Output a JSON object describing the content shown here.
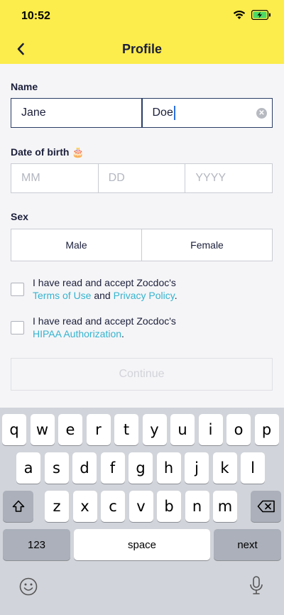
{
  "status": {
    "time": "10:52"
  },
  "nav": {
    "title": "Profile"
  },
  "form": {
    "name_label": "Name",
    "first_name": "Jane",
    "last_name": "Doe",
    "dob_label": "Date of birth",
    "dob_emoji": "🎂",
    "dob_month_placeholder": "MM",
    "dob_day_placeholder": "DD",
    "dob_year_placeholder": "YYYY",
    "sex_label": "Sex",
    "sex_male": "Male",
    "sex_female": "Female",
    "terms_prefix": "I have read and accept Zocdoc's",
    "terms_link": "Terms of Use",
    "terms_and": "and",
    "privacy_link": "Privacy Policy",
    "terms_period": ".",
    "hipaa_prefix": "I have read and accept Zocdoc's",
    "hipaa_link": "HIPAA Authorization",
    "hipaa_period": ".",
    "continue_label": "Continue"
  },
  "keyboard": {
    "row1": [
      "q",
      "w",
      "e",
      "r",
      "t",
      "y",
      "u",
      "i",
      "o",
      "p"
    ],
    "row2": [
      "a",
      "s",
      "d",
      "f",
      "g",
      "h",
      "j",
      "k",
      "l"
    ],
    "row3": [
      "z",
      "x",
      "c",
      "v",
      "b",
      "n",
      "m"
    ],
    "numbers_label": "123",
    "space_label": "space",
    "next_label": "next"
  },
  "colors": {
    "header": "#fcec4c",
    "link": "#36b3cf",
    "text": "#1b1f3b"
  },
  "icons": [
    "back-chevron-icon",
    "wifi-icon",
    "battery-charging-icon",
    "clear-icon",
    "shift-icon",
    "backspace-icon",
    "emoji-icon",
    "microphone-icon"
  ]
}
